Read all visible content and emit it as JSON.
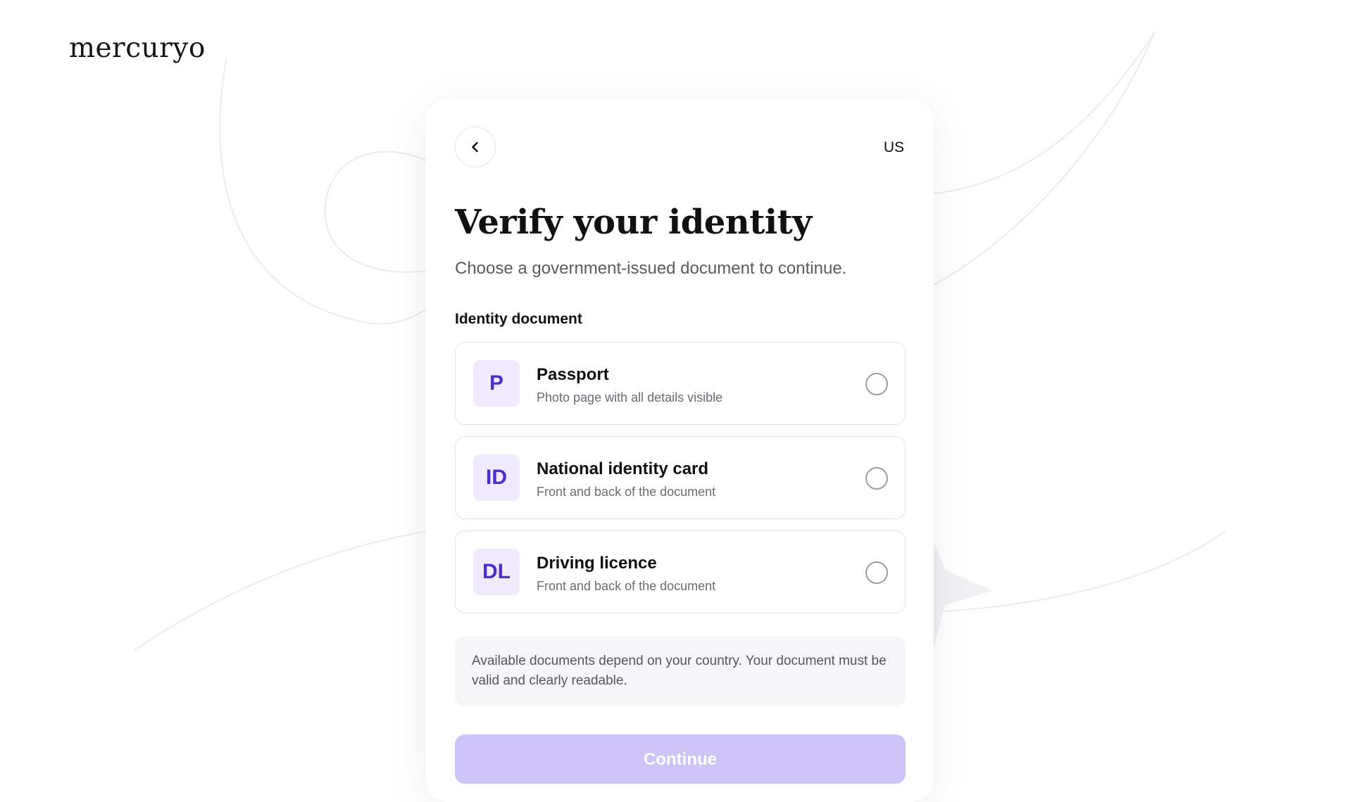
{
  "brand": {
    "logo_text": "mercuryo"
  },
  "header": {
    "back_icon": "chevron-left-icon",
    "country": "US"
  },
  "content": {
    "title": "Verify your identity",
    "subtitle": "Choose a government-issued document to continue.",
    "section_label": "Identity document"
  },
  "documents": [
    {
      "badge": "P",
      "title": "Passport",
      "description": "Photo page with all details visible",
      "selected": false
    },
    {
      "badge": "ID",
      "title": "National identity card",
      "description": "Front and back of the document",
      "selected": false
    },
    {
      "badge": "DL",
      "title": "Driving licence",
      "description": "Front and back of the document",
      "selected": false
    }
  ],
  "info": {
    "text": "Available documents depend on your country. Your document must be valid and clearly readable."
  },
  "actions": {
    "continue_label": "Continue",
    "continue_enabled": false
  },
  "colors": {
    "accent": "#4a2fc9",
    "badge_bg": "#efeafd",
    "button_disabled": "#cdc3f7"
  }
}
